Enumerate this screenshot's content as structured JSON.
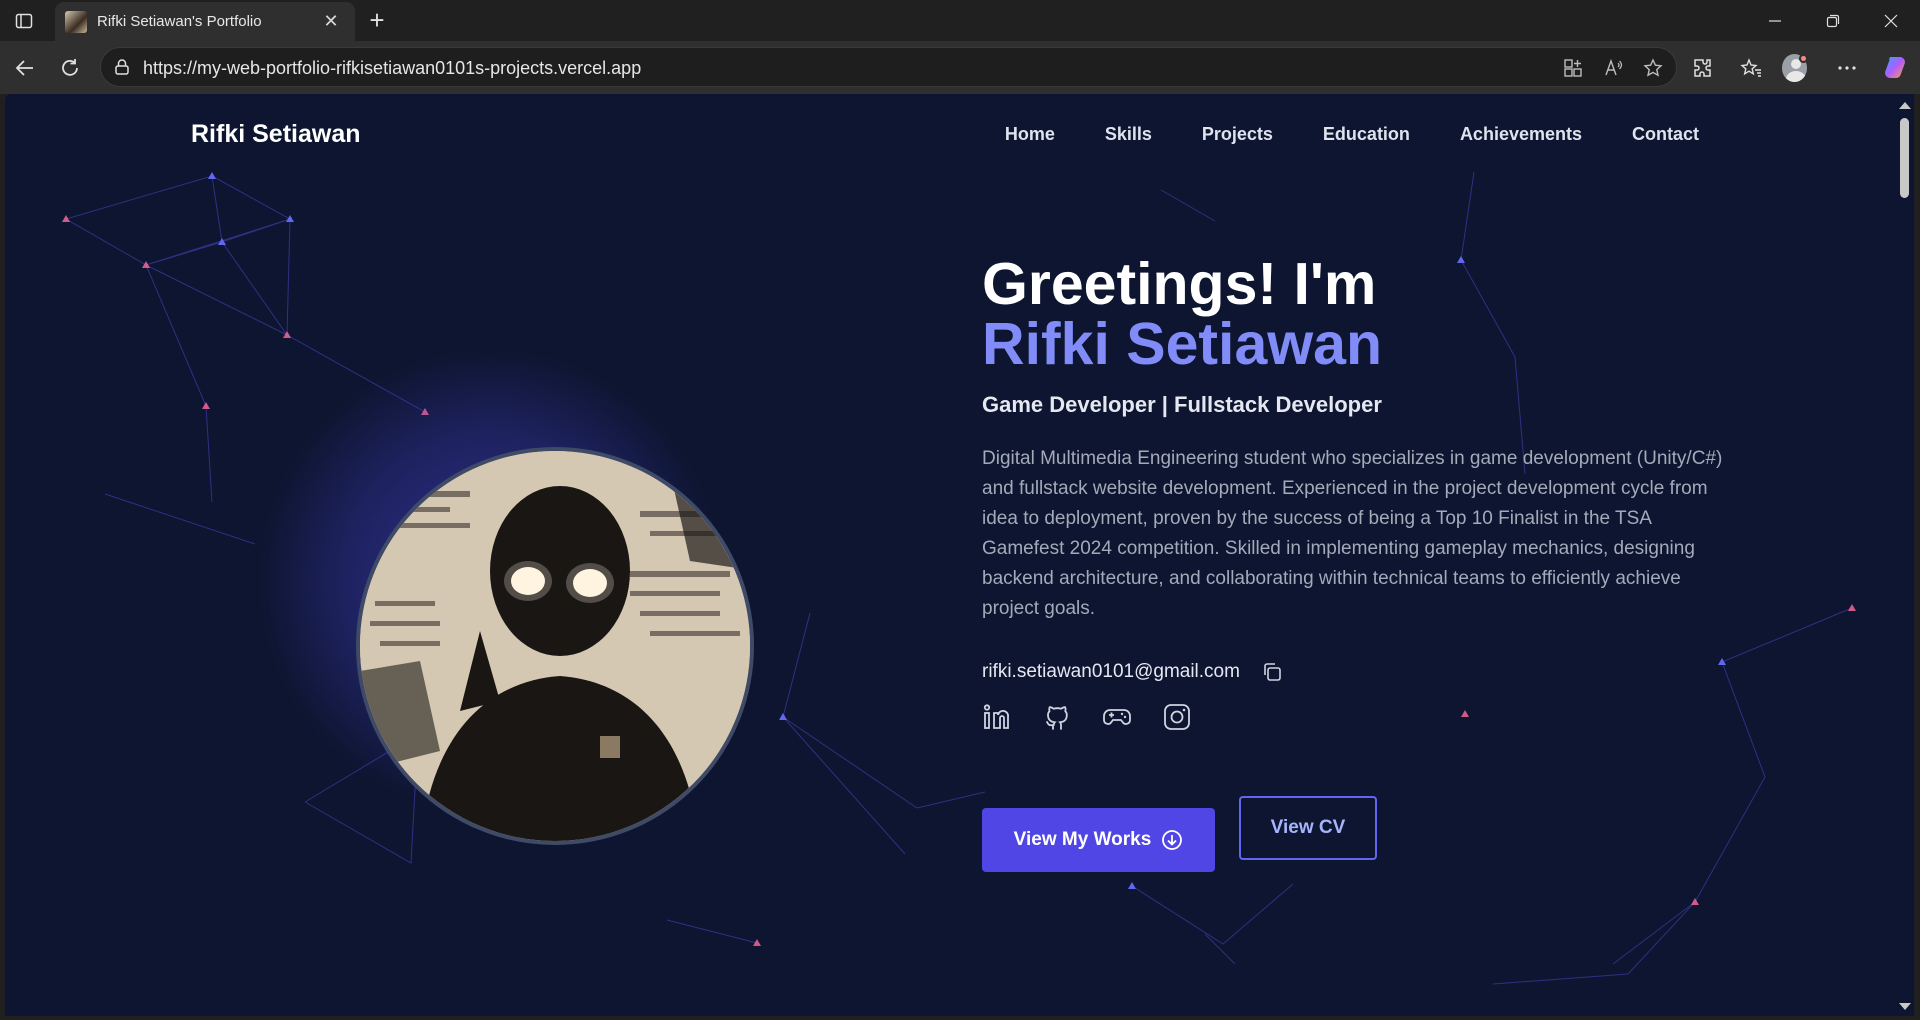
{
  "browser": {
    "tab_title": "Rifki Setiawan's Portfolio",
    "url": "https://my-web-portfolio-rifkisetiawan0101s-projects.vercel.app",
    "new_tab_symbol": "+",
    "close_symbol": "✕"
  },
  "site": {
    "logo": "Rifki Setiawan",
    "nav": [
      "Home",
      "Skills",
      "Projects",
      "Education",
      "Achievements",
      "Contact"
    ]
  },
  "hero": {
    "greeting": "Greetings! I'm",
    "name": "Rifki Setiawan",
    "role": "Game Developer | Fullstack Developer",
    "bio": "Digital Multimedia Engineering student who specializes in game development (Unity/C#) and fullstack website development. Experienced in the project development cycle from idea to deployment, proven by the success of being a Top 10 Finalist in the TSA Gamefest 2024 competition. Skilled in implementing gameplay mechanics, designing backend architecture, and collaborating within technical teams to efficiently achieve project goals.",
    "email": "rifki.setiawan0101@gmail.com",
    "socials": [
      "linkedin-icon",
      "github-icon",
      "gamepad-icon",
      "instagram-icon"
    ],
    "primary_button": "View My Works",
    "secondary_button": "View CV"
  },
  "colors": {
    "background": "#0d1530",
    "accent": "#818cf8",
    "button": "#4f46e5"
  }
}
